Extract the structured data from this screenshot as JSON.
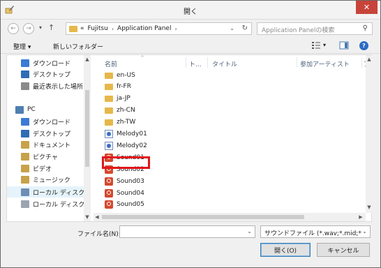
{
  "window": {
    "title": "開く",
    "close_glyph": "✕"
  },
  "nav": {
    "back_glyph": "←",
    "forward_glyph": "→",
    "recent_glyph": "▾",
    "up_glyph": "↑"
  },
  "address": {
    "overflow": "«",
    "crumbs": [
      "Fujitsu",
      "Application Panel"
    ],
    "separator": "›",
    "dropdown_glyph": "⌄",
    "refresh_glyph": "↻"
  },
  "search": {
    "placeholder": "Application Panelの検索",
    "icon_glyph": "⚲"
  },
  "toolbar": {
    "organize": "整理 ▾",
    "new_folder": "新しいフォルダー",
    "view_glyph": "▾",
    "help_glyph": "?"
  },
  "navpane": {
    "items": [
      {
        "label": "ダウンロード",
        "icon": "downloads-icon",
        "color": "#3a7bd5"
      },
      {
        "label": "デスクトップ",
        "icon": "desktop-icon",
        "color": "#2f6db5"
      },
      {
        "label": "最近表示した場所",
        "icon": "recent-places-icon",
        "color": "#8a8a8a"
      },
      {
        "label": "PC",
        "icon": "pc-icon",
        "color": "#4f7fb0"
      },
      {
        "label": "ダウンロード",
        "icon": "downloads-icon",
        "color": "#3a7bd5"
      },
      {
        "label": "デスクトップ",
        "icon": "desktop-icon",
        "color": "#2f6db5"
      },
      {
        "label": "ドキュメント",
        "icon": "documents-icon",
        "color": "#c7a24a"
      },
      {
        "label": "ピクチャ",
        "icon": "pictures-icon",
        "color": "#c7a24a"
      },
      {
        "label": "ビデオ",
        "icon": "videos-icon",
        "color": "#c7a24a"
      },
      {
        "label": "ミュージック",
        "icon": "music-icon",
        "color": "#c7a24a"
      },
      {
        "label": "ローカル ディスク (C",
        "icon": "local-disk-icon",
        "color": "#6d8fb7"
      },
      {
        "label": "ローカル ディスク (D",
        "icon": "local-disk-icon",
        "color": "#9aa5b1"
      }
    ]
  },
  "columns": {
    "name": "名前",
    "sort_glyph": "^",
    "track": "ト...",
    "title": "タイトル",
    "artist": "参加アーティスト",
    "more": "ア"
  },
  "files": [
    {
      "name": "en-US",
      "type": "folder"
    },
    {
      "name": "fr-FR",
      "type": "folder"
    },
    {
      "name": "ja-JP",
      "type": "folder"
    },
    {
      "name": "zh-CN",
      "type": "folder"
    },
    {
      "name": "zh-TW",
      "type": "folder"
    },
    {
      "name": "Melody01",
      "type": "midi"
    },
    {
      "name": "Melody02",
      "type": "midi"
    },
    {
      "name": "Sound01",
      "type": "sound"
    },
    {
      "name": "Sound02",
      "type": "sound"
    },
    {
      "name": "Sound03",
      "type": "sound"
    },
    {
      "name": "Sound04",
      "type": "sound"
    },
    {
      "name": "Sound05",
      "type": "sound"
    }
  ],
  "highlighted_file": "Sound01",
  "scroll": {
    "up": "▲",
    "down": "▼",
    "left": "◀",
    "right": "▶"
  },
  "bottom": {
    "filename_label": "ファイル名(N):",
    "filename_value": "",
    "filter_value": "サウンドファイル (*.wav;*.mid;*",
    "dropdown_glyph": "⌄",
    "open_button": "開く(O)",
    "cancel_button": "キャンセル"
  },
  "colors": {
    "highlight": "#e2151b",
    "close": "#c7443a"
  }
}
